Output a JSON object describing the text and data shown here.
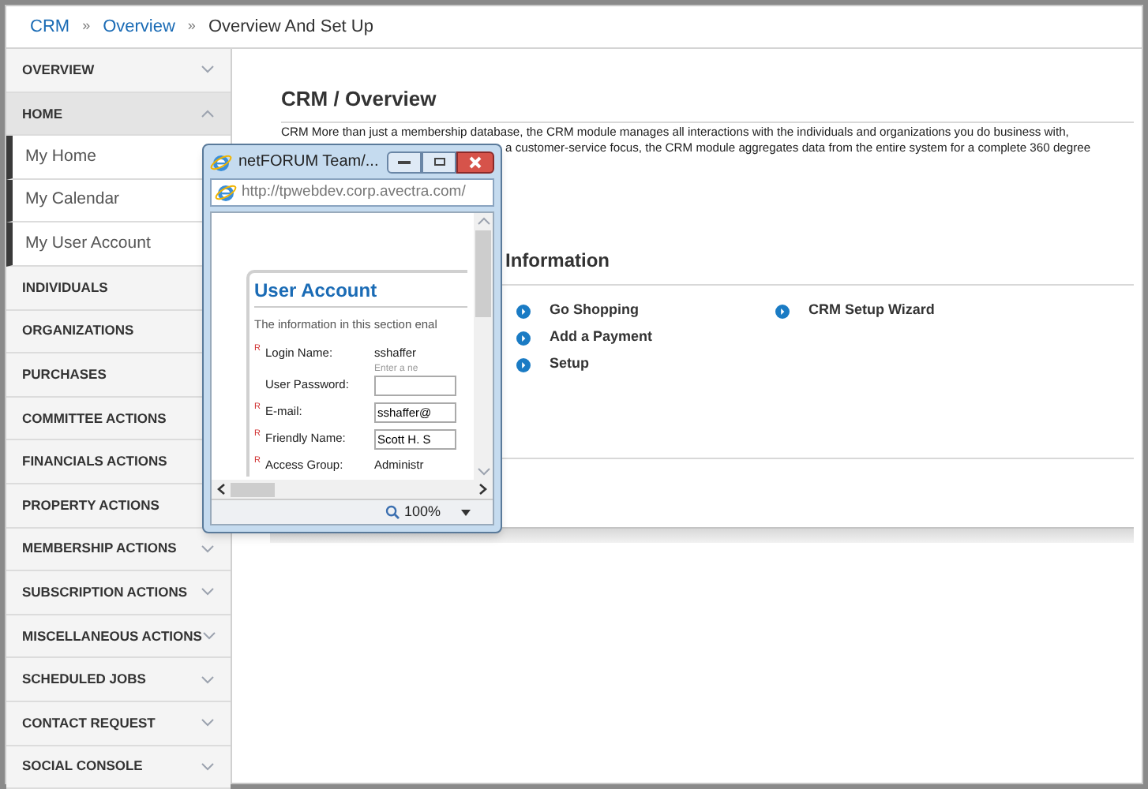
{
  "breadcrumb": [
    {
      "label": "CRM",
      "link": true
    },
    {
      "label": "Overview",
      "link": true
    },
    {
      "label": "Overview And Set Up",
      "link": false
    }
  ],
  "breadcrumb_separator": "»",
  "sidebar": {
    "items": [
      {
        "label": "OVERVIEW",
        "kind": "section",
        "expanded": false
      },
      {
        "label": "HOME",
        "kind": "section",
        "expanded": true
      },
      {
        "label": "My Home",
        "kind": "sub"
      },
      {
        "label": "My Calendar",
        "kind": "sub"
      },
      {
        "label": "My User Account",
        "kind": "sub"
      },
      {
        "label": "INDIVIDUALS",
        "kind": "section"
      },
      {
        "label": "ORGANIZATIONS",
        "kind": "section"
      },
      {
        "label": "PURCHASES",
        "kind": "section"
      },
      {
        "label": "COMMITTEE ACTIONS",
        "kind": "section"
      },
      {
        "label": "FINANCIALS ACTIONS",
        "kind": "section"
      },
      {
        "label": "PROPERTY ACTIONS",
        "kind": "section"
      },
      {
        "label": "MEMBERSHIP ACTIONS",
        "kind": "section",
        "expanded": false
      },
      {
        "label": "SUBSCRIPTION ACTIONS",
        "kind": "section",
        "expanded": false
      },
      {
        "label": "MISCELLANEOUS ACTIONS",
        "kind": "section",
        "expanded": false
      },
      {
        "label": "SCHEDULED JOBS",
        "kind": "section",
        "expanded": false
      },
      {
        "label": "CONTACT REQUEST",
        "kind": "section",
        "expanded": false
      },
      {
        "label": "SOCIAL CONSOLE",
        "kind": "section",
        "expanded": false
      }
    ]
  },
  "main": {
    "title": "CRM / Overview",
    "description_lines": [
      "CRM More than just a membership database, the CRM module manages all interactions with the individuals and organizations you do business with,",
      "a customer-service focus, the CRM module aggregates data from the entire system for a complete 360 degree"
    ],
    "section_title": "Information",
    "link_columns": [
      [
        {
          "label": "Go Shopping"
        },
        {
          "label": "Add a Payment"
        },
        {
          "label": "Setup"
        }
      ],
      [
        {
          "label": "CRM Setup Wizard"
        }
      ]
    ]
  },
  "popup": {
    "title": "netFORUM Team/...",
    "url": "http://tpwebdev.corp.avectra.com/",
    "zoom": "100%",
    "panel_title": "User Account",
    "intro": "The information in this section enal",
    "fields": [
      {
        "label": "Login Name:",
        "required_mark": "R",
        "kind": "text",
        "value": "sshaffer"
      },
      {
        "label": "User Password:",
        "kind": "input",
        "hint": "Enter a ne"
      },
      {
        "label": "E-mail:",
        "required_mark": "R",
        "kind": "input",
        "value": "sshaffer@"
      },
      {
        "label": "Friendly Name:",
        "required_mark": "R",
        "kind": "input",
        "value": "Scott H. S"
      },
      {
        "label": "Access Group:",
        "required_mark": "R",
        "kind": "text",
        "value": "Administr"
      }
    ]
  }
}
